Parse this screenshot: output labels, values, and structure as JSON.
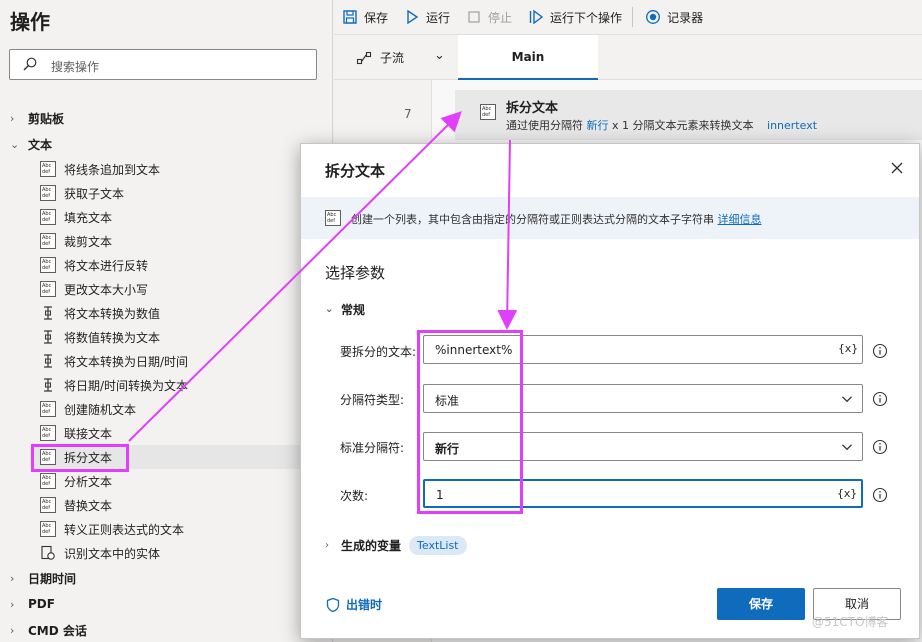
{
  "left_panel": {
    "title": "操作",
    "search_placeholder": "搜索操作",
    "categories": [
      {
        "label": "剪贴板",
        "expanded": false
      },
      {
        "label": "文本",
        "expanded": true
      },
      {
        "label": "日期时间",
        "expanded": false
      },
      {
        "label": "PDF",
        "expanded": false
      },
      {
        "label": "CMD 会话",
        "expanded": false
      }
    ],
    "text_actions": [
      {
        "label": "将线条追加到文本",
        "icon": "abc-def-icon"
      },
      {
        "label": "获取子文本",
        "icon": "abc-def-icon"
      },
      {
        "label": "填充文本",
        "icon": "abc-def-icon"
      },
      {
        "label": "裁剪文本",
        "icon": "abc-def-icon"
      },
      {
        "label": "将文本进行反转",
        "icon": "abc-def-icon"
      },
      {
        "label": "更改文本大小写",
        "icon": "abc-def-icon"
      },
      {
        "label": "将文本转换为数值",
        "icon": "convert-icon"
      },
      {
        "label": "将数值转换为文本",
        "icon": "convert-icon"
      },
      {
        "label": "将文本转换为日期/时间",
        "icon": "convert-icon"
      },
      {
        "label": "将日期/时间转换为文本",
        "icon": "convert-icon"
      },
      {
        "label": "创建随机文本",
        "icon": "abc-def-icon"
      },
      {
        "label": "联接文本",
        "icon": "abc-def-icon"
      },
      {
        "label": "拆分文本",
        "icon": "abc-def-icon",
        "selected": true
      },
      {
        "label": "分析文本",
        "icon": "abc-def-icon"
      },
      {
        "label": "替换文本",
        "icon": "abc-def-icon"
      },
      {
        "label": "转义正则表达式的文本",
        "icon": "abc-def-icon"
      },
      {
        "label": "识别文本中的实体",
        "icon": "entity-icon"
      }
    ]
  },
  "toolbar": {
    "save_label": "保存",
    "run_label": "运行",
    "stop_label": "停止",
    "run_next_label": "运行下个操作",
    "recorder_label": "记录器"
  },
  "tabs": {
    "subflow_label": "子流",
    "main_label": "Main"
  },
  "canvas": {
    "line_number": "7",
    "action_title": "拆分文本",
    "action_desc_prefix": "通过使用分隔符",
    "action_desc_sep": "新行",
    "action_desc_mid": "x 1 分隔文本元素来转换文本",
    "action_desc_var": "innertext"
  },
  "dialog": {
    "title": "拆分文本",
    "info_text": "创建一个列表，其中包含由指定的分隔符或正则表达式分隔的文本子字符串",
    "info_link": "详细信息",
    "section_title": "选择参数",
    "group_label": "常规",
    "params": [
      {
        "label": "要拆分的文本:",
        "value": "%innertext%",
        "kind": "text"
      },
      {
        "label": "分隔符类型:",
        "value": "标准",
        "kind": "dropdown"
      },
      {
        "label": "标准分隔符:",
        "value": "新行",
        "kind": "dropdown"
      },
      {
        "label": "次数:",
        "value": "1",
        "kind": "text"
      }
    ],
    "var_button": "{x}",
    "produced_vars_label": "生成的变量",
    "produced_var": "TextList",
    "on_error_label": "出错时",
    "save_label": "保存",
    "cancel_label": "取消"
  },
  "watermark": "@51CTO博客",
  "colors": {
    "accent": "#0f6cbd",
    "annotation": "#e040fb"
  }
}
